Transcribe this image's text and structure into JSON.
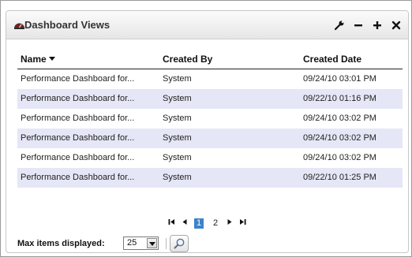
{
  "panel": {
    "title": "Dashboard Views",
    "title_icon": "dashboard-gauge-icon",
    "tools": [
      {
        "name": "wrench-icon"
      },
      {
        "name": "minimize-icon"
      },
      {
        "name": "add-icon"
      },
      {
        "name": "close-icon"
      }
    ]
  },
  "table": {
    "columns": [
      "Name",
      "Created By",
      "Created Date"
    ],
    "sorted_column": "Name",
    "rows": [
      [
        "Performance Dashboard for...",
        "System",
        "09/24/10 03:01 PM"
      ],
      [
        "Performance Dashboard for...",
        "System",
        "09/22/10 01:16 PM"
      ],
      [
        "Performance Dashboard for...",
        "System",
        "09/24/10 03:02 PM"
      ],
      [
        "Performance Dashboard for...",
        "System",
        "09/24/10 03:02 PM"
      ],
      [
        "Performance Dashboard for...",
        "System",
        "09/24/10 03:02 PM"
      ],
      [
        "Performance Dashboard for...",
        "System",
        "09/22/10 01:25 PM"
      ]
    ]
  },
  "pager": {
    "pages": [
      "1",
      "2"
    ],
    "current_page": "1"
  },
  "footer": {
    "max_items_label": "Max items displayed:",
    "max_items_value": "25"
  },
  "colors": {
    "alt_row": "#e5e6f6",
    "active_page": "#3d82c9"
  }
}
